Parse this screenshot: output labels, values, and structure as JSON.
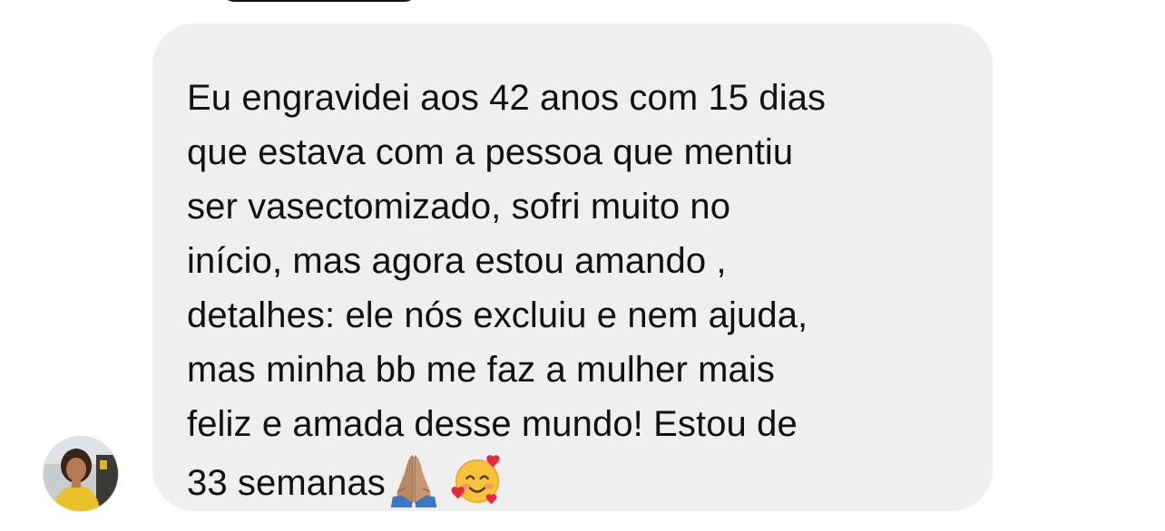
{
  "message": {
    "text": "Eu engravidei aos 42 anos com 15 dias\nque estava com a pessoa que mentiu\nser vasectomizado, sofri muito no\ninício, mas agora estou amando ,\ndetalhes: ele nós excluiu e nem ajuda,\nmas minha bb me faz a mulher mais\nfeliz e amada desse mundo! Estou de\n33 semanas",
    "emojis": [
      "folded-hands-icon",
      "smiling-face-with-hearts-icon"
    ]
  },
  "colors": {
    "bubble_background": "#efefef",
    "text": "#111111",
    "page_background": "#ffffff"
  }
}
